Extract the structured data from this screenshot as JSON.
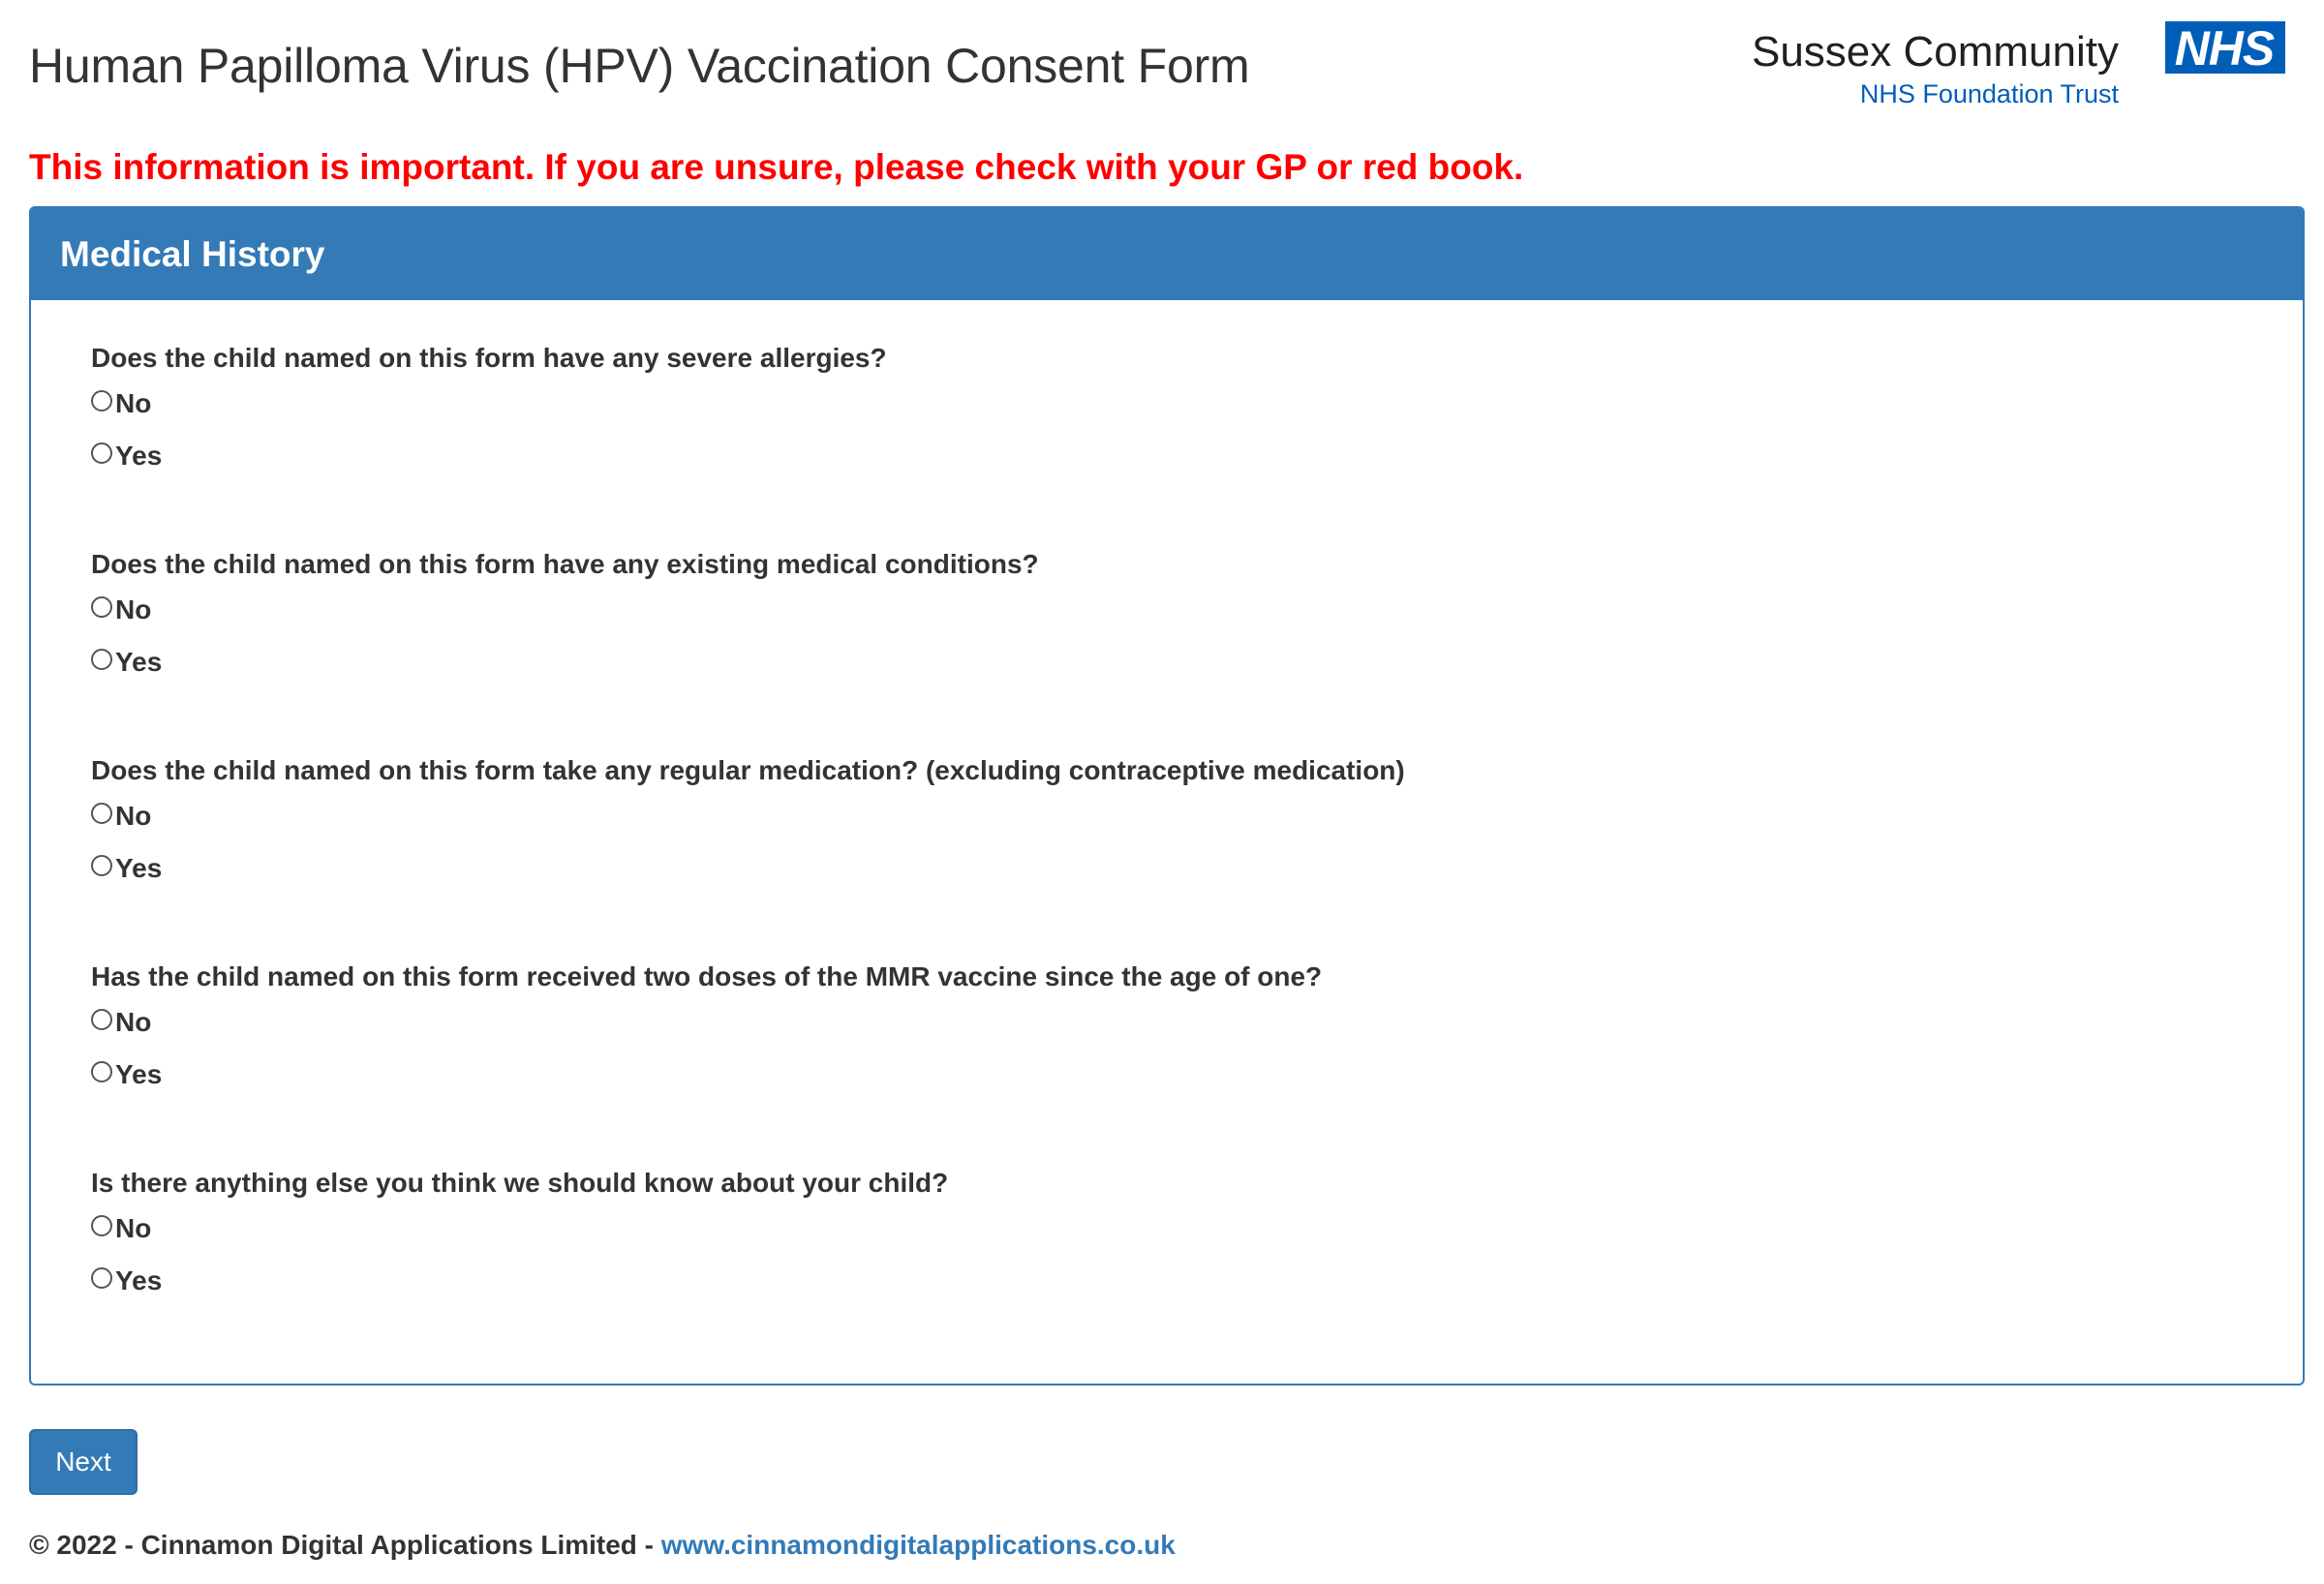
{
  "header": {
    "title": "Human Papilloma Virus (HPV) Vaccination Consent Form",
    "logo": {
      "organisation": "Sussex Community",
      "trust": "NHS Foundation Trust",
      "badge": "NHS"
    }
  },
  "warning": "This information is important. If you are unsure, please check with your GP or red book.",
  "panel": {
    "title": "Medical History",
    "questions": [
      {
        "label": "Does the child named on this form have any severe allergies?",
        "options": [
          "No",
          "Yes"
        ]
      },
      {
        "label": "Does the child named on this form have any existing medical conditions?",
        "options": [
          "No",
          "Yes"
        ]
      },
      {
        "label": "Does the child named on this form take any regular medication? (excluding contraceptive medication)",
        "options": [
          "No",
          "Yes"
        ]
      },
      {
        "label": "Has the child named on this form received two doses of the MMR vaccine since the age of one?",
        "options": [
          "No",
          "Yes"
        ]
      },
      {
        "label": "Is there anything else you think we should know about your child?",
        "options": [
          "No",
          "Yes"
        ]
      }
    ]
  },
  "next_label": "Next",
  "footer": {
    "copyright": "© 2022 - Cinnamon Digital Applications Limited - ",
    "link_text": "www.cinnamondigitalapplications.co.uk"
  },
  "colors": {
    "primary": "#337ab7",
    "warning": "#ff0000",
    "nhs_blue": "#005eb8",
    "text": "#333333"
  }
}
